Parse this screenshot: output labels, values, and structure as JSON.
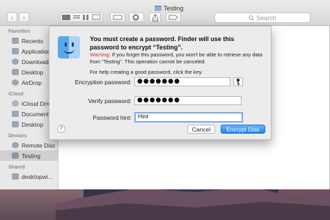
{
  "window": {
    "title": "Testing"
  },
  "toolbar": {
    "back_icon": "‹",
    "forward_icon": "›",
    "search_placeholder": "Search"
  },
  "sidebar": {
    "sections": [
      {
        "label": "Favorites",
        "items": [
          "Recents",
          "Applications",
          "Downloads",
          "Desktop",
          "AirDrop"
        ]
      },
      {
        "label": "iCloud",
        "items": [
          "iCloud Drive",
          "Documents",
          "Desktop"
        ]
      },
      {
        "label": "Devices",
        "items": [
          "Remote Disc",
          "Testing"
        ]
      },
      {
        "label": "Shared",
        "items": [
          "desktopwi..."
        ]
      }
    ],
    "selected": "Testing"
  },
  "dialog": {
    "title": "You must create a password. Finder will use this password to encrypt “Testing”.",
    "warning_label": "Warning:",
    "warning_text": " If you forget this password, you won't be able to retrieve any data from “Testing”. This operation cannot be canceled.",
    "help_text": "For help creating a good password, click the key.",
    "encryption_label": "Encryption password:",
    "encryption_value": "●●●●●●●",
    "verify_label": "Verify password:",
    "verify_value": "●●●●●●●",
    "hint_label": "Password hint:",
    "hint_value": "Hint",
    "cancel_label": "Cancel",
    "encrypt_label": "Encrypt Disk",
    "help_button": "?"
  },
  "colors": {
    "accent": "#1f82f0",
    "warning": "#d0312d"
  }
}
